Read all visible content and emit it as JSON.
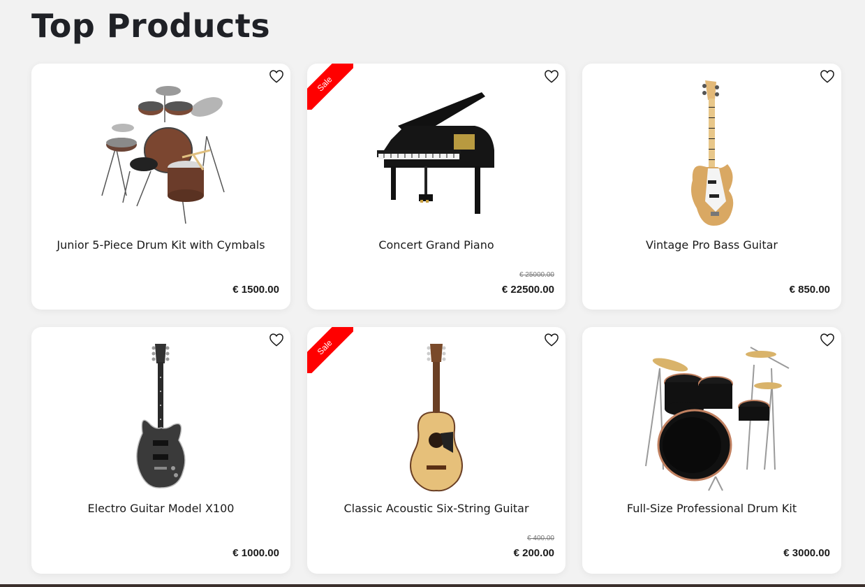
{
  "page": {
    "title": "Top Products"
  },
  "products": [
    {
      "name": "Junior 5-Piece Drum Kit with Cymbals",
      "price": "€ 1500.00",
      "old_price": "",
      "sale": false,
      "image": "drum-kit-wood"
    },
    {
      "name": "Concert Grand Piano",
      "price": "€ 22500.00",
      "old_price": "€ 25000.00",
      "sale": true,
      "sale_label": "Sale",
      "image": "grand-piano"
    },
    {
      "name": "Vintage Pro Bass Guitar",
      "price": "€ 850.00",
      "old_price": "",
      "sale": false,
      "image": "bass-guitar"
    },
    {
      "name": "Electro Guitar Model X100",
      "price": "€ 1000.00",
      "old_price": "",
      "sale": false,
      "image": "electric-guitar"
    },
    {
      "name": "Classic Acoustic Six-String Guitar",
      "price": "€ 200.00",
      "old_price": "€ 400.00",
      "sale": true,
      "sale_label": "Sale",
      "image": "acoustic-guitar"
    },
    {
      "name": "Full-Size Professional Drum Kit",
      "price": "€ 3000.00",
      "old_price": "",
      "sale": false,
      "image": "drum-kit-black"
    }
  ],
  "colors": {
    "sale_ribbon": "#ff0000",
    "background": "#f2f2f2",
    "card": "#ffffff"
  },
  "icons": {
    "favorite": "heart-outline-icon"
  }
}
